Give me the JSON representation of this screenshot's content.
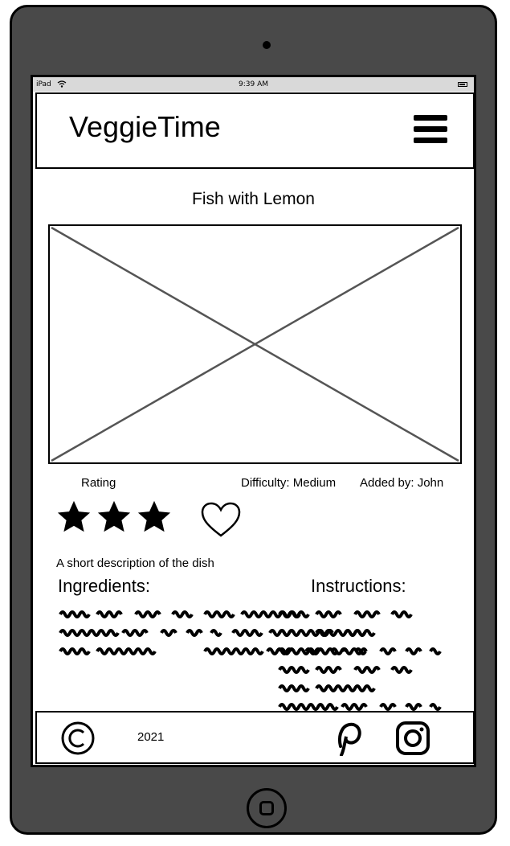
{
  "status": {
    "carrier": "iPad",
    "time": "9:39 AM"
  },
  "header": {
    "brand": "VeggieTime",
    "menu_icon": "hamburger-menu-icon"
  },
  "recipe": {
    "title": "Fish with Lemon",
    "image_placeholder": "image-placeholder",
    "rating_label": "Rating",
    "rating_stars": 3,
    "difficulty": "Difficulty: Medium",
    "added_by": "Added by: John",
    "favorite_icon": "heart-icon",
    "description": "A short description of the dish",
    "ingredients_heading": "Ingredients:",
    "instructions_heading": "Instructions:"
  },
  "footer": {
    "copyright_icon": "copyright-icon",
    "year": "2021",
    "social": [
      "pinterest-icon",
      "instagram-icon"
    ]
  }
}
